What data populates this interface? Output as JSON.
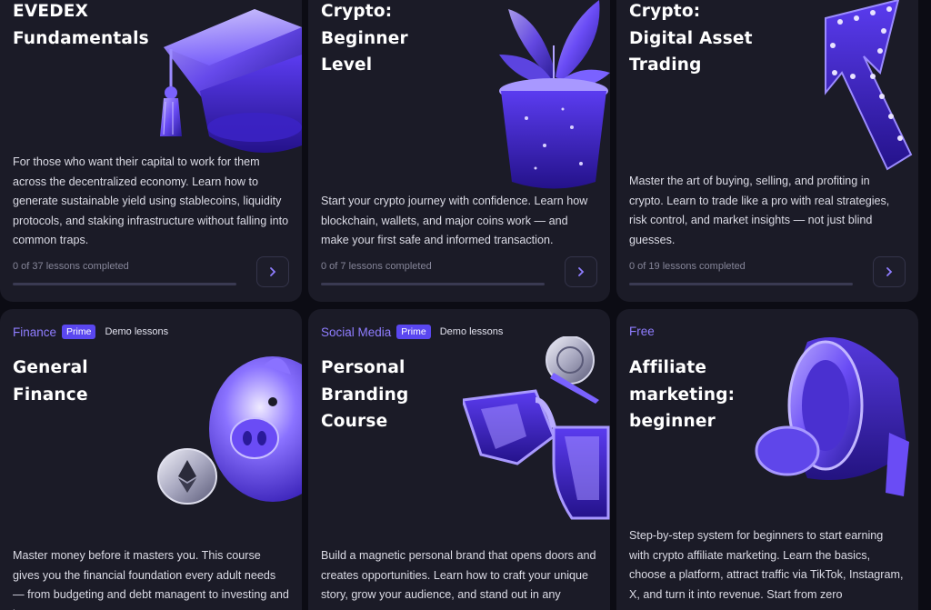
{
  "colors": {
    "background": "#0c0c14",
    "card": "#1b1b27",
    "accent": "#6f5cff",
    "category_text": "#8f7dff",
    "prime_badge": "#5a47f0",
    "muted_text": "#868699"
  },
  "courses": [
    {
      "title_lines": [
        "EVEDEX",
        "Fundamentals"
      ],
      "description": "For those who want their capital to work for them across the decentralized economy. Learn how to generate sustainable yield using stablecoins, liquidity protocols, and staking infrastructure without falling into common traps.",
      "progress_text": "0 of 37 lessons completed",
      "progress_fraction": 0,
      "art_icon": "graduation-cap-icon"
    },
    {
      "title_lines": [
        "Crypto:",
        "Beginner",
        "Level"
      ],
      "description": "Start your crypto journey with confidence. Learn how blockchain, wallets, and major coins work — and make your first safe and informed transaction.",
      "progress_text": "0 of 7 lessons completed",
      "progress_fraction": 0,
      "art_icon": "potted-plant-icon"
    },
    {
      "title_lines": [
        "Crypto:",
        "Digital Asset",
        "Trading"
      ],
      "description": "Master the art of buying, selling, and profiting in crypto. Learn to trade like a pro with real strategies, risk control, and market insights — not just blind guesses.",
      "progress_text": "0 of 19 lessons completed",
      "progress_fraction": 0,
      "art_icon": "arrow-up-icon"
    },
    {
      "category": "Finance",
      "prime_label": "Prime",
      "demo_label": "Demo lessons",
      "title_lines": [
        "General",
        "Finance"
      ],
      "description": "Master money before it masters you. This course gives you the financial foundation every adult needs — from budgeting and debt managent to investing and long-",
      "art_icon": "piggy-bank-icon"
    },
    {
      "category": "Social Media",
      "prime_label": "Prime",
      "demo_label": "Demo lessons",
      "title_lines": [
        "Personal",
        "Branding",
        "Course"
      ],
      "description": "Build a magnetic personal brand that opens doors and creates opportunities. Learn how to craft your unique story, grow your audience, and stand out in any",
      "art_icon": "sunglasses-icon"
    },
    {
      "category": "Free",
      "title_lines": [
        "Affiliate",
        "marketing:",
        "beginner"
      ],
      "description": "Step-by-step system for beginners to start earning with crypto affiliate marketing. Learn the basics, choose a platform, attract traffic via TikTok, Instagram, X, and turn it into revenue. Start from zero",
      "art_icon": "megaphone-icon"
    }
  ]
}
